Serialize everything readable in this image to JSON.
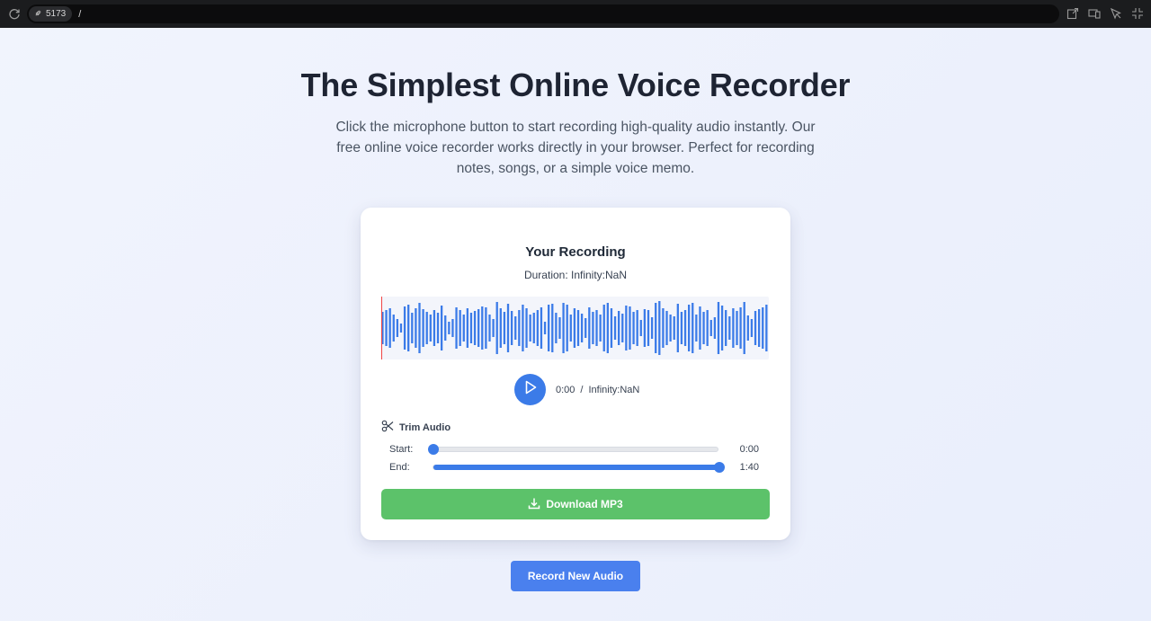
{
  "browser": {
    "port": "5173",
    "path": "/"
  },
  "header": {
    "title": "The Simplest Online Voice Recorder",
    "subtitle": "Click the microphone button to start recording high-quality audio instantly. Our free online voice recorder works directly in your browser. Perfect for recording notes, songs, or a simple voice memo."
  },
  "recording": {
    "title": "Your Recording",
    "duration": "Duration: Infinity:NaN",
    "current_time": "0:00",
    "separator": "/",
    "total_time": "Infinity:NaN",
    "wave_color": "#3b7be8",
    "playhead_color": "#ef4444"
  },
  "trim": {
    "heading": "Trim Audio",
    "start_label": "Start:",
    "start_value": "0:00",
    "start_fraction": 0.0,
    "end_label": "End:",
    "end_value": "1:40",
    "end_fraction": 1.0
  },
  "actions": {
    "download_label": "Download MP3",
    "record_new_label": "Record New Audio"
  },
  "colors": {
    "accent": "#3b7be8",
    "download": "#5cc26a",
    "record": "#4a80ee"
  }
}
